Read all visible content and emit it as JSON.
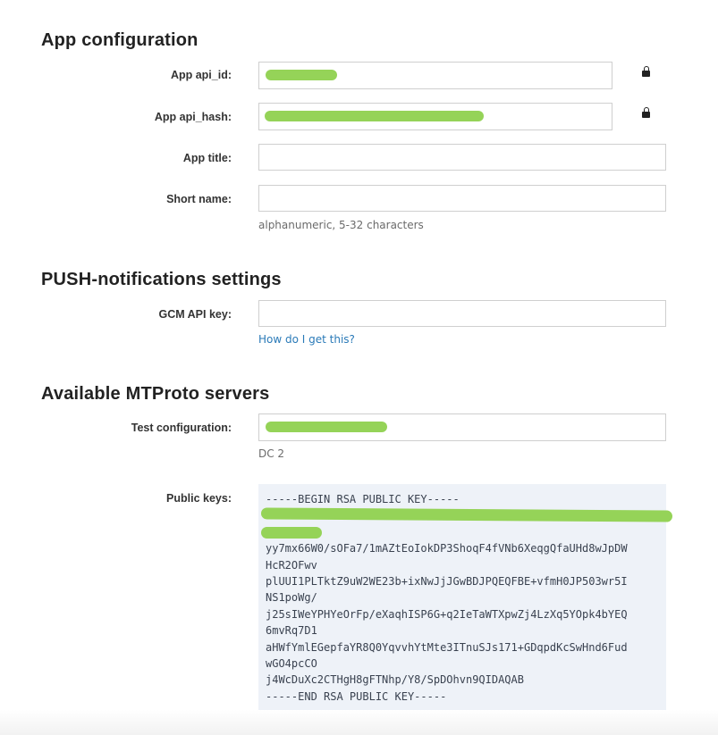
{
  "sections": {
    "app_config": "App configuration",
    "push": "PUSH-notifications settings",
    "mtproto": "Available MTProto servers"
  },
  "fields": {
    "api_id_label": "App api_id:",
    "api_id_value": "",
    "api_hash_label": "App api_hash:",
    "api_hash_value": "",
    "app_title_label": "App title:",
    "app_title_value": "",
    "short_name_label": "Short name:",
    "short_name_value": "",
    "short_name_help": "alphanumeric, 5-32 characters",
    "gcm_label": "GCM API key:",
    "gcm_value": "",
    "gcm_link": "How do I get this?",
    "test_config_label": "Test configuration:",
    "test_config_value": "",
    "test_config_help": "DC 2",
    "public_keys_label": "Public keys:"
  },
  "public_keys": {
    "begin": "-----BEGIN RSA PUBLIC KEY-----",
    "lines": [
      "",
      "",
      "yy7mx66W0/sOFa7/1mAZtEoIokDP3ShoqF4fVNb6XeqgQfaUHd8wJpDW",
      "HcR2OFwv",
      "plUUI1PLTktZ9uW2WE23b+ixNwJjJGwBDJPQEQFBE+vfmH0JP503wr5I",
      "NS1poWg/",
      "j25sIWeYPHYeOrFp/eXaqhISP6G+q2IeTaWTXpwZj4LzXq5YOpk4bYEQ",
      "6mvRq7D1",
      "aHWfYmlEGepfaYR8Q0YqvvhYtMte3ITnuSJs171+GDqpdKcSwHnd6Fud",
      "wGO4pcCO",
      "j4WcDuXc2CTHgH8gFTNhp/Y8/SpDOhvn9QIDAQAB"
    ],
    "end": "-----END RSA PUBLIC KEY-----"
  },
  "icons": {
    "lock": "lock-icon"
  },
  "colors": {
    "link": "#2a7ab8",
    "keys_bg": "#eef2f8",
    "redaction": "#8fd14f"
  }
}
